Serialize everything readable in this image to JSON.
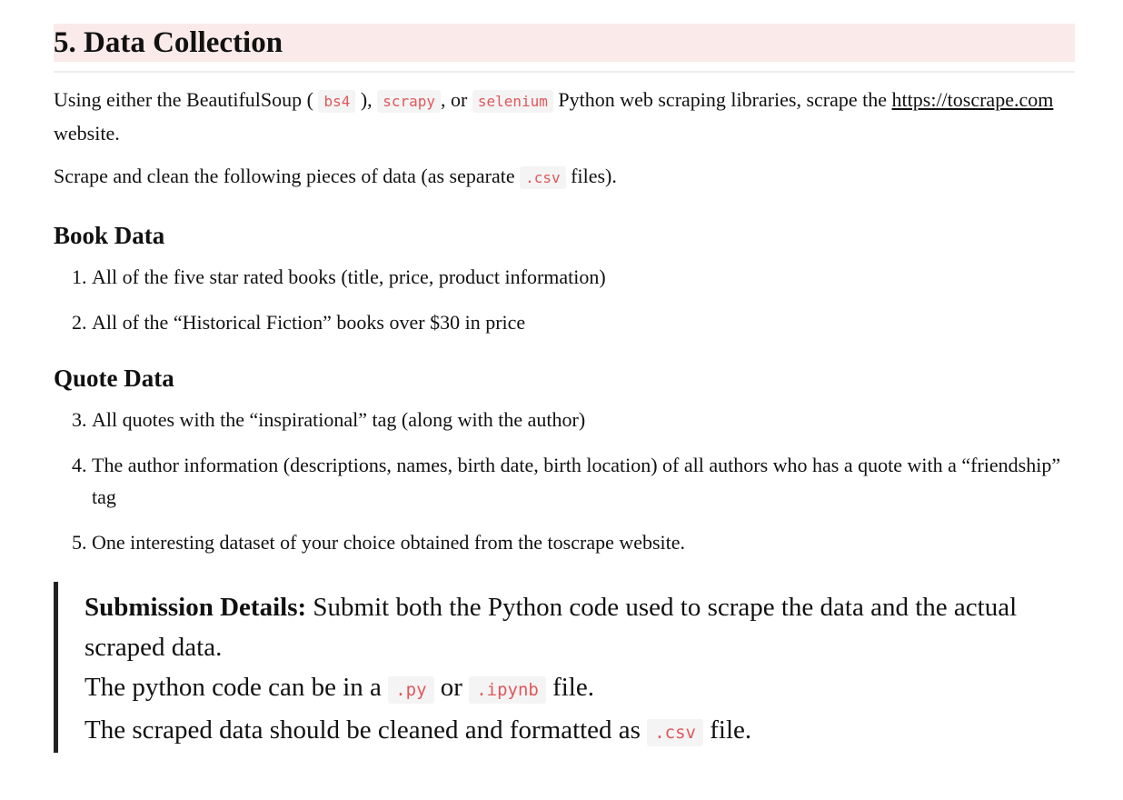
{
  "section": {
    "title": "5. Data Collection"
  },
  "intro": {
    "p1_a": "Using either the BeautifulSoup ( ",
    "code_bs4": "bs4",
    "p1_b": " ), ",
    "code_scrapy": "scrapy",
    "p1_c": ", or ",
    "code_selenium": "selenium",
    "p1_d": " Python web scraping libraries, scrape the ",
    "link": "https://toscrape.com",
    "p1_e": " website.",
    "p2_a": "Scrape and clean the following pieces of data (as separate ",
    "code_csv": ".csv",
    "p2_b": " files)."
  },
  "book": {
    "heading": "Book Data",
    "items": [
      "All of the five star rated books (title, price, product information)",
      "All of the “Historical Fiction” books over $30 in price"
    ]
  },
  "quote": {
    "heading": "Quote Data",
    "items": [
      "All quotes with the “inspirational” tag (along with the author)",
      "The author information (descriptions, names, birth date, birth location) of all authors who has a quote with a “friendship” tag",
      "One interesting dataset of your choice obtained from the toscrape website."
    ]
  },
  "submission": {
    "label": "Submission Details:",
    "line1": " Submit both the Python code used to scrape the data and the actual scraped data.",
    "line2_a": "The python code can be in a ",
    "code_py": ".py",
    "line2_b": " or ",
    "code_ipynb": ".ipynb",
    "line2_c": " file.",
    "line3_a": "The scraped data should be cleaned and formatted as ",
    "code_csv": ".csv",
    "line3_b": " file."
  }
}
